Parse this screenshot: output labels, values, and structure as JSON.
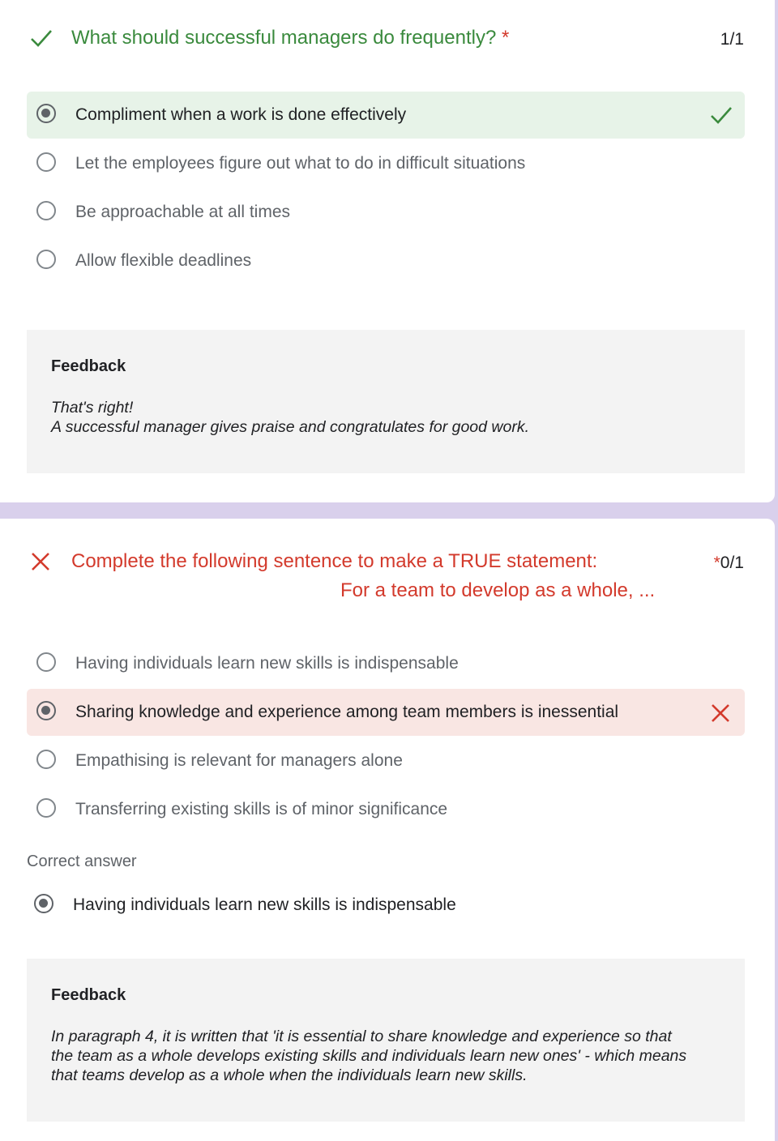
{
  "questions": [
    {
      "title": "What should successful managers do frequently?",
      "required_mark": "*",
      "points": "1/1",
      "status": "correct",
      "options": [
        {
          "label": "Compliment when a work is done effectively",
          "selected": true,
          "result": "correct"
        },
        {
          "label": "Let the employees figure out what to do in difficult situations",
          "selected": false
        },
        {
          "label": "Be approachable at all times",
          "selected": false
        },
        {
          "label": "Allow flexible deadlines",
          "selected": false
        }
      ],
      "feedback": {
        "title": "Feedback",
        "line1": "That's right!",
        "line2": "A successful manager gives praise and congratulates for good work."
      }
    },
    {
      "title_line1": "Complete the following sentence to make a TRUE statement:",
      "title_line2": "For a team to develop as a whole, ...",
      "required_mark": "*",
      "points": "0/1",
      "status": "incorrect",
      "options": [
        {
          "label": "Having individuals learn new skills is indispensable",
          "selected": false
        },
        {
          "label": "Sharing knowledge and experience among team members is inessential",
          "selected": true,
          "result": "incorrect"
        },
        {
          "label": "Empathising is relevant for managers alone",
          "selected": false
        },
        {
          "label": "Transferring existing skills is of minor significance",
          "selected": false
        }
      ],
      "correct_answer_label": "Correct answer",
      "correct_answer": "Having individuals learn new skills is indispensable",
      "feedback": {
        "title": "Feedback",
        "line1": "In paragraph 4, it is written that 'it is essential to share knowledge and experience so that",
        "line2": "the team as a whole develops existing skills and individuals learn new ones' - which means",
        "line3": "that teams develop as a whole when the individuals learn new skills."
      }
    }
  ],
  "colors": {
    "correct": "#3a8a3d",
    "incorrect": "#d33a2c",
    "correct_bg": "#e7f3e8",
    "incorrect_bg": "#f9e6e3",
    "page_bg": "#d9d0ec"
  },
  "icons": {
    "correct": "checkmark-icon",
    "incorrect": "x-mark-icon"
  }
}
